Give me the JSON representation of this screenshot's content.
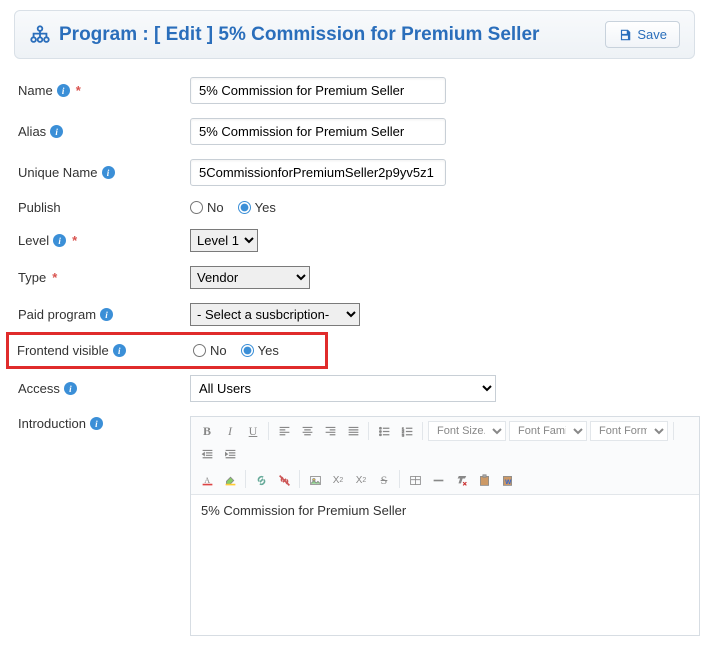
{
  "header": {
    "title_prefix": "Program :",
    "edit_label": "[ Edit ]",
    "program_name": "5% Commission for Premium Seller",
    "save_label": "Save"
  },
  "fields": {
    "name": {
      "label": "Name",
      "value": "5% Commission for Premium Seller",
      "required": true,
      "info": true
    },
    "alias": {
      "label": "Alias",
      "value": "5% Commission for Premium Seller",
      "required": false,
      "info": true
    },
    "unique": {
      "label": "Unique Name",
      "value": "5CommissionforPremiumSeller2p9yv5z1",
      "required": false,
      "info": true
    },
    "publish": {
      "label": "Publish",
      "no": "No",
      "yes": "Yes",
      "value": "Yes"
    },
    "level": {
      "label": "Level",
      "required": true,
      "info": true,
      "selected": "Level 1",
      "options": [
        "Level 1"
      ]
    },
    "type": {
      "label": "Type",
      "required": true,
      "selected": "Vendor",
      "options": [
        "Vendor"
      ]
    },
    "paid": {
      "label": "Paid program",
      "info": true,
      "selected": "- Select a susbcription-",
      "options": [
        "- Select a susbcription-"
      ]
    },
    "frontend": {
      "label": "Frontend visible",
      "info": true,
      "no": "No",
      "yes": "Yes",
      "value": "Yes"
    },
    "access": {
      "label": "Access",
      "info": true,
      "selected": "All Users",
      "options": [
        "All Users"
      ]
    },
    "intro": {
      "label": "Introduction",
      "info": true,
      "content": "5% Commission for Premium Seller"
    }
  },
  "editor_toolbar": {
    "font_size": "Font Size...",
    "font_family": "Font Family.",
    "font_format": "Font Format"
  }
}
